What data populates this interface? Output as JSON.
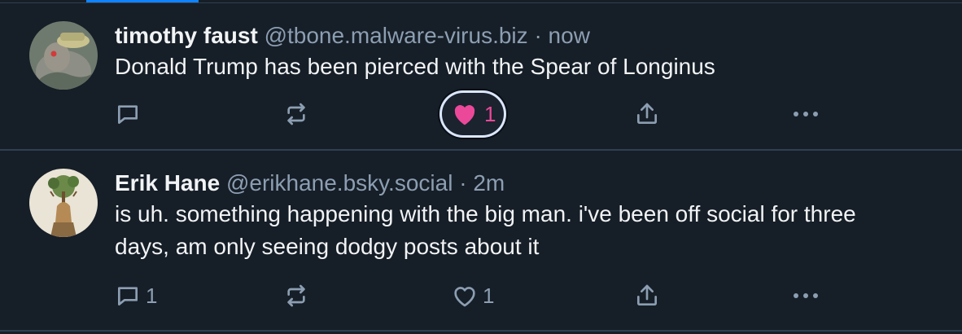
{
  "posts": [
    {
      "author": "timothy faust",
      "handle": "@tbone.malware-virus.biz",
      "separator": "·",
      "time": "now",
      "text": "Donald Trump has been pierced with the Spear of Longinus",
      "avatar_icon": "user-avatar-photo",
      "actions": {
        "reply_count": "",
        "repost_count": "",
        "like_count": "1",
        "liked": true
      }
    },
    {
      "author": "Erik Hane",
      "handle": "@erikhane.bsky.social",
      "separator": "·",
      "time": "2m",
      "text": "is uh. something happening with the big man. i've been off social for three days, am only seeing dodgy posts about it",
      "avatar_icon": "user-avatar-illustration",
      "actions": {
        "reply_count": "1",
        "repost_count": "",
        "like_count": "1",
        "liked": false
      }
    }
  ],
  "colors": {
    "background": "#161e27",
    "divider": "#2e4052",
    "muted_text": "#8c9eb2",
    "primary_text": "#f1f3f5",
    "like_active": "#ec4899",
    "accent": "#1083fe"
  },
  "icons": {
    "reply": "reply-icon",
    "repost": "repost-icon",
    "like": "heart-icon",
    "share": "share-icon",
    "more": "more-icon"
  }
}
